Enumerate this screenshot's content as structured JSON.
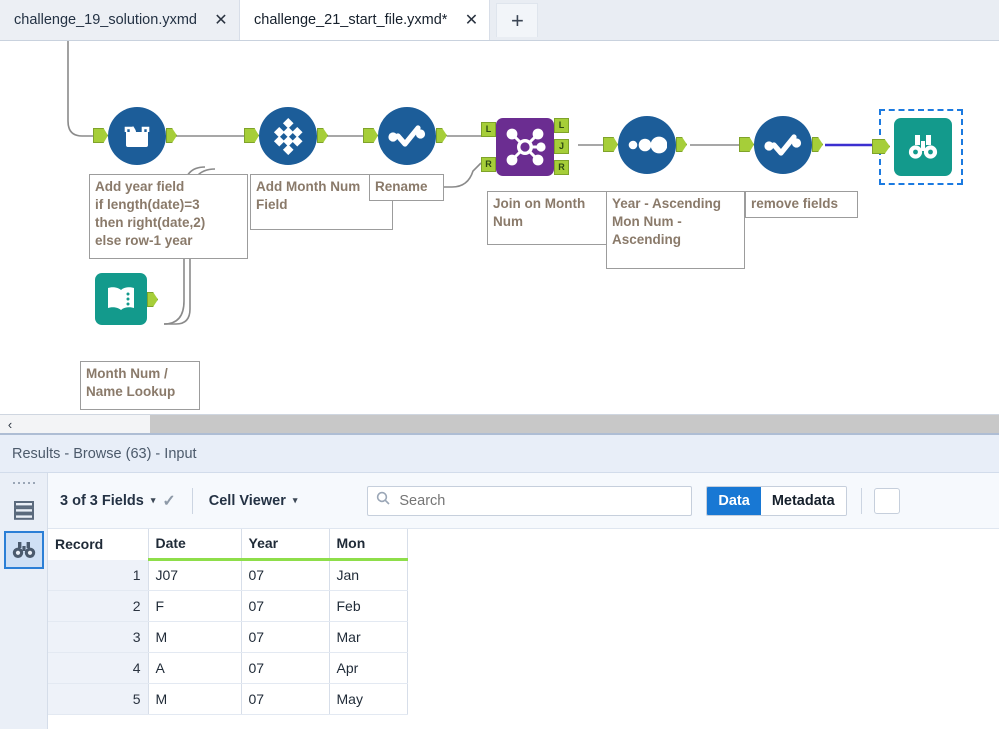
{
  "tabs": [
    {
      "label": "challenge_19_solution.yxmd",
      "active": false,
      "close_icon": "✕"
    },
    {
      "label": "challenge_21_start_file.yxmd*",
      "active": true,
      "close_icon": "✕"
    }
  ],
  "tab_add_label": "+",
  "canvas": {
    "nodes": [
      {
        "id": "data-cleansing",
        "icon": "data-cleansing-icon",
        "shape": "circle",
        "color": "#1c5d99"
      },
      {
        "id": "multi-field-formula",
        "icon": "multi-field-formula-icon",
        "shape": "circle",
        "color": "#1c5d99"
      },
      {
        "id": "select",
        "icon": "select-icon",
        "shape": "circle",
        "color": "#1c5d99"
      },
      {
        "id": "join",
        "icon": "join-icon",
        "shape": "square",
        "color": "#6b2d91"
      },
      {
        "id": "sort",
        "icon": "sort-icon",
        "shape": "circle",
        "color": "#1c5d99"
      },
      {
        "id": "select-2",
        "icon": "select-icon",
        "shape": "circle",
        "color": "#1c5d99"
      },
      {
        "id": "browse",
        "icon": "browse-binoculars-icon",
        "shape": "square",
        "color": "#139a8c"
      },
      {
        "id": "text-input-lookup",
        "icon": "text-input-book-icon",
        "shape": "square",
        "color": "#139a8c"
      }
    ],
    "join_ports": {
      "in_left": "L",
      "in_right": "R",
      "out_left": "L",
      "out_join": "J",
      "out_right": "R"
    },
    "annotations": [
      {
        "id": "add-year-field",
        "text": "Add year field\nif length(date)=3\nthen right(date,2)\nelse row-1 year"
      },
      {
        "id": "add-month-num-field",
        "text": "Add Month Num\nField"
      },
      {
        "id": "rename",
        "text": "Rename"
      },
      {
        "id": "join-on-month-num",
        "text": "Join on Month\nNum"
      },
      {
        "id": "sort-order",
        "text": "Year - Ascending\nMon Num -\nAscending"
      },
      {
        "id": "remove-fields",
        "text": "remove fields"
      },
      {
        "id": "month-num-name-lookup",
        "text": "Month Num /\nName Lookup"
      }
    ]
  },
  "scrollbar": {
    "left_chevron": "‹"
  },
  "results": {
    "title": "Results - Browse (63) - Input",
    "vtoolbar": [
      {
        "id": "rows-icon",
        "selected": false
      },
      {
        "id": "browse-binoculars-icon",
        "selected": true
      }
    ],
    "toolbar": {
      "fields_label": "3 of 3 Fields",
      "fields_caret": "▾",
      "check_icon": "✓",
      "viewer_label": "Cell Viewer",
      "viewer_caret": "▾",
      "search_placeholder": "Search",
      "search_value": "",
      "search_icon": "search-icon",
      "data_label": "Data",
      "metadata_label": "Metadata",
      "data_selected": true
    },
    "table": {
      "columns": [
        "Record",
        "Date",
        "Year",
        "Mon"
      ],
      "rows": [
        [
          "1",
          "J07",
          "07",
          "Jan"
        ],
        [
          "2",
          "F",
          "07",
          "Feb"
        ],
        [
          "3",
          "M",
          "07",
          "Mar"
        ],
        [
          "4",
          "A",
          "07",
          "Apr"
        ],
        [
          "5",
          "M",
          "07",
          "May"
        ]
      ]
    }
  },
  "colors": {
    "accent_blue": "#1878d4",
    "node_blue": "#1c5d99",
    "node_purple": "#6b2d91",
    "node_teal": "#139a8c",
    "port_green": "#a6ce39",
    "header_underline": "#8ede4a",
    "selection_blue": "#1b7ae0"
  }
}
